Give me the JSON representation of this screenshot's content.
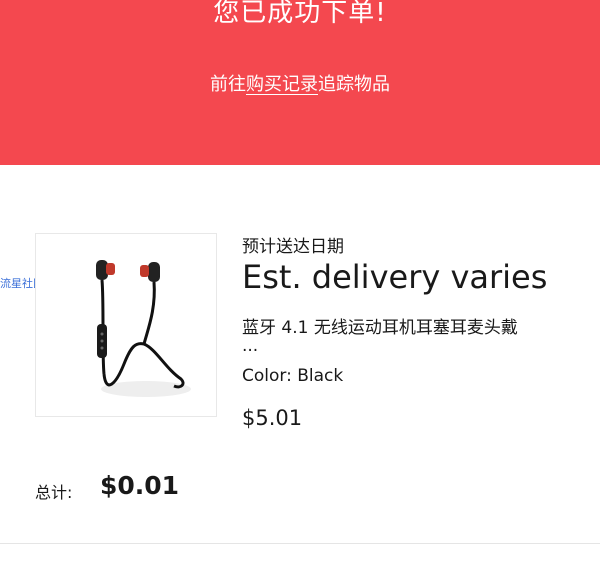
{
  "banner": {
    "title": "您已成功下单!",
    "subtitle_before": "前往",
    "subtitle_link": "购买记录",
    "subtitle_after": "追踪物品",
    "background_color": "#f4484f"
  },
  "watermark": "流星社区",
  "order_item": {
    "image_icon": "earphones-icon",
    "delivery_label": "预计送达日期",
    "delivery_value": "Est. delivery varies",
    "title": "蓝牙 4.1 无线运动耳机耳塞耳麦头戴",
    "title_overflow": "...",
    "color": "Color: Black",
    "price": "$5.01"
  },
  "summary": {
    "total_label": "总计:",
    "total_value": "$0.01"
  }
}
